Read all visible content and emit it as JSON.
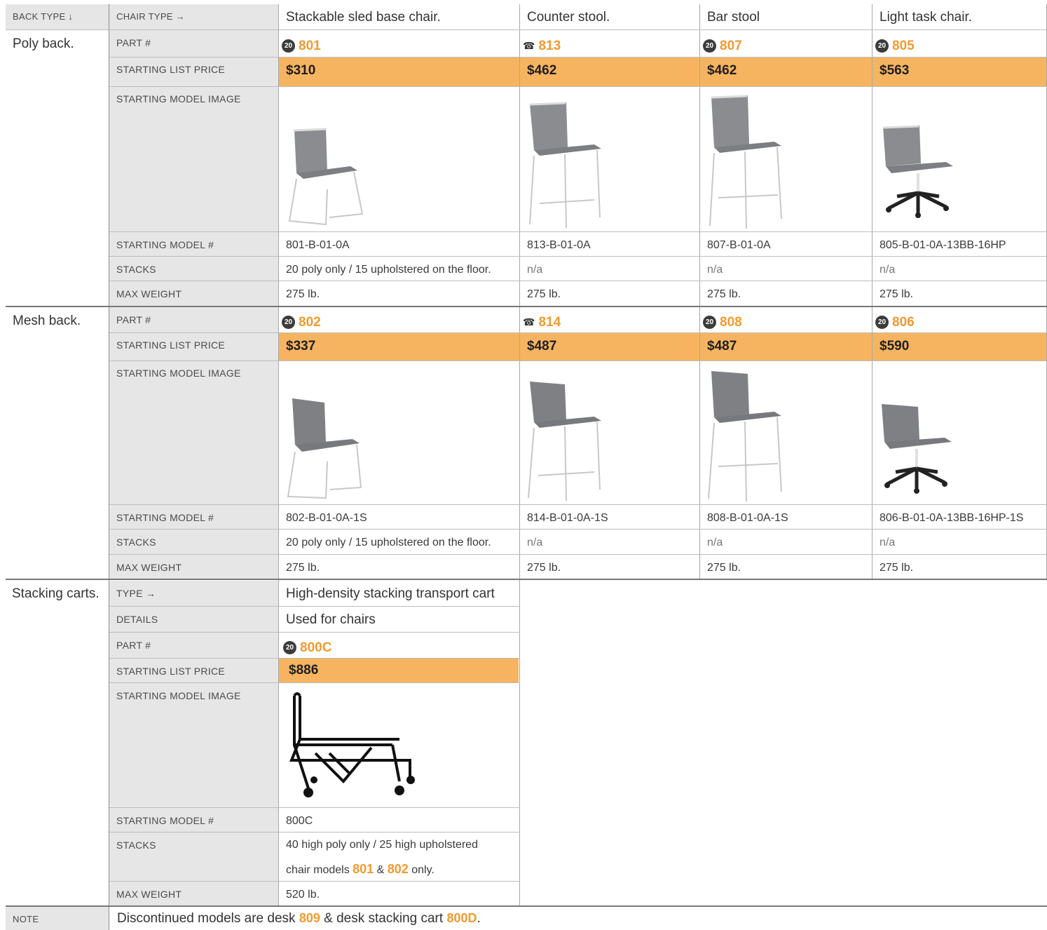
{
  "header": {
    "back_type": "BACK TYPE ↓",
    "chair_type": "CHAIR TYPE →",
    "columns": [
      "Stackable sled base chair.",
      "Counter stool.",
      "Bar stool",
      "Light task chair."
    ]
  },
  "row_labels": {
    "part": "PART #",
    "price": "STARTING LIST PRICE",
    "image": "STARTING MODEL IMAGE",
    "model": "STARTING MODEL #",
    "stacks": "STACKS",
    "weight": "MAX WEIGHT",
    "type": "TYPE →",
    "details": "DETAILS"
  },
  "poly": {
    "label": "Poly back.",
    "parts": [
      {
        "badge": "20",
        "part": "801",
        "icon": "badge-20-icon"
      },
      {
        "badge": "☎",
        "part": "813",
        "icon": "phone-icon"
      },
      {
        "badge": "20",
        "part": "807",
        "icon": "badge-20-icon"
      },
      {
        "badge": "20",
        "part": "805",
        "icon": "badge-20-icon"
      }
    ],
    "prices": [
      "$310",
      "$462",
      "$462",
      "$563"
    ],
    "models": [
      "801-B-01-0A",
      "813-B-01-0A",
      "807-B-01-0A",
      "805-B-01-0A-13BB-16HP"
    ],
    "stacks": [
      "20 poly only / 15 upholstered on the floor.",
      "n/a",
      "n/a",
      "n/a"
    ],
    "weights": [
      "275 lb.",
      "275 lb.",
      "275 lb.",
      "275 lb."
    ]
  },
  "mesh": {
    "label": "Mesh back.",
    "parts": [
      {
        "badge": "20",
        "part": "802",
        "icon": "badge-20-icon"
      },
      {
        "badge": "☎",
        "part": "814",
        "icon": "phone-icon"
      },
      {
        "badge": "20",
        "part": "808",
        "icon": "badge-20-icon"
      },
      {
        "badge": "20",
        "part": "806",
        "icon": "badge-20-icon"
      }
    ],
    "prices": [
      "$337",
      "$487",
      "$487",
      "$590"
    ],
    "models": [
      "802-B-01-0A-1S",
      "814-B-01-0A-1S",
      "808-B-01-0A-1S",
      "806-B-01-0A-13BB-16HP-1S"
    ],
    "stacks": [
      "20 poly only / 15 upholstered on the floor.",
      "n/a",
      "n/a",
      "n/a"
    ],
    "weights": [
      "275 lb.",
      "275 lb.",
      "275 lb.",
      "275 lb."
    ]
  },
  "carts": {
    "label": "Stacking carts.",
    "type": "High-density stacking transport cart",
    "details": "Used for chairs",
    "badge": "20",
    "part": "800C",
    "price": "$886",
    "model": "800C",
    "stacks_line1": "40 high poly only / 25 high upholstered",
    "stacks_line2_pre": "chair models ",
    "stacks_part_a": "801",
    "stacks_amp": " & ",
    "stacks_part_b": "802",
    "stacks_line2_post": " only.",
    "weight": "520 lb."
  },
  "note": {
    "label": "NOTE",
    "pre": "Discontinued models are desk ",
    "part_a": "809",
    "mid": " & desk stacking cart ",
    "part_b": "800D",
    "post": "."
  },
  "colors": {
    "accent": "#f29a2e",
    "price_bg": "#f6b461",
    "label_bg": "#e6e6e7"
  }
}
